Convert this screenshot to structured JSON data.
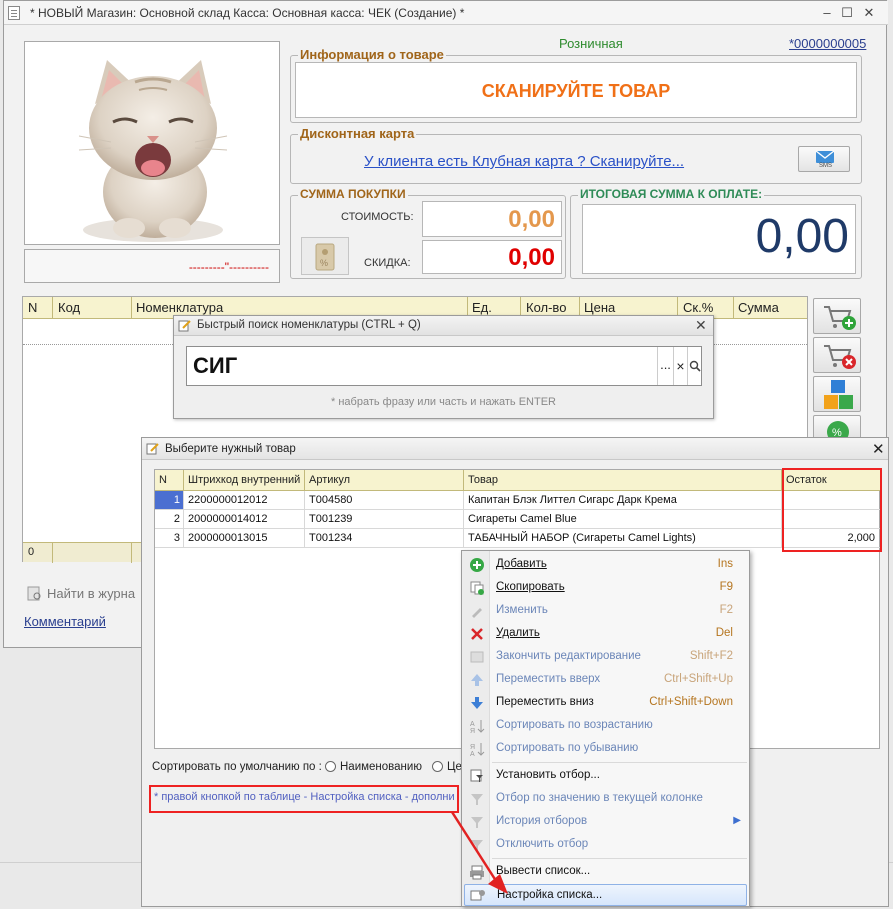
{
  "window": {
    "title": "* НОВЫЙ Магазин: Основной склад Касса: Основная касса: ЧЕК (Создание) *"
  },
  "header": {
    "price_type": "Розничная",
    "check_number": "*0000000005"
  },
  "photo": {
    "caption": "---------\"----------"
  },
  "product_info": {
    "title": "Информация о товаре",
    "scan_prompt": "СКАНИРУЙТЕ ТОВАР"
  },
  "discount_card": {
    "title": "Дисконтная карта",
    "link": "У клиента есть Клубная карта ? Сканируйте...",
    "sms_label": "SMS"
  },
  "purchase_sum": {
    "title": "СУММА ПОКУПКИ",
    "cost_label": "СТОИМОСТЬ:",
    "cost_value": "0,00",
    "discount_label": "СКИДКА:",
    "discount_value": "0,00"
  },
  "total": {
    "title": "ИТОГОВАЯ СУММА К ОПЛАТЕ:",
    "value": "0,00"
  },
  "grid": {
    "columns": [
      "N",
      "Код",
      "Номенклатура",
      "Ед.",
      "Кол-во",
      "Цена",
      "Ск.%",
      "Сумма"
    ],
    "footer_count": "0"
  },
  "bottom_links": {
    "find_in_journal": "Найти в журна",
    "comment": "Комментарий"
  },
  "quick_search": {
    "title": "Быстрый поиск номенклатуры (CTRL + Q)",
    "value": "СИГ",
    "ellipsis": "...",
    "clear": "×",
    "hint": "* набрать фразу или часть и нажать ENTER"
  },
  "select_dialog": {
    "title": "Выберите нужный товар",
    "columns": [
      "N",
      "Штрихкод внутренний",
      "Артикул",
      "Товар",
      "Остаток"
    ],
    "rows": [
      {
        "n": "1",
        "barcode": "2200000012012",
        "article": "Т004580",
        "name": "Капитан Блэк Литтел Сигарс Дарк Крема",
        "stock": ""
      },
      {
        "n": "2",
        "barcode": "2000000014012",
        "article": "Т001239",
        "name": "Сигареты Camel Blue",
        "stock": ""
      },
      {
        "n": "3",
        "barcode": "2000000013015",
        "article": "Т001234",
        "name": "ТАБАЧНЫЙ НАБОР (Сигареты Camel Lights)",
        "stock": "2,000"
      }
    ],
    "sort_label": "Сортировать по умолчанию по :",
    "sort_option_name": "Наименованию",
    "sort_option_other": "Цен",
    "footer_hint": "* правой кнопкой по таблице - Настройка списка - дополни"
  },
  "context_menu": {
    "items": [
      {
        "label": "Добавить",
        "shortcut": "Ins"
      },
      {
        "label": "Скопировать",
        "shortcut": "F9"
      },
      {
        "label": "Изменить",
        "shortcut": "F2"
      },
      {
        "label": "Удалить",
        "shortcut": "Del"
      },
      {
        "label": "Закончить редактирование",
        "shortcut": "Shift+F2"
      },
      {
        "label": "Переместить вверх",
        "shortcut": "Ctrl+Shift+Up"
      },
      {
        "label": "Переместить вниз",
        "shortcut": "Ctrl+Shift+Down"
      },
      {
        "label": "Сортировать по возрастанию",
        "shortcut": ""
      },
      {
        "label": "Сортировать по убыванию",
        "shortcut": ""
      },
      {
        "label": "Установить отбор...",
        "shortcut": ""
      },
      {
        "label": "Отбор по значению в текущей колонке",
        "shortcut": ""
      },
      {
        "label": "История отборов",
        "shortcut": ""
      },
      {
        "label": "Отключить отбор",
        "shortcut": ""
      },
      {
        "label": "Вывести список...",
        "shortcut": ""
      },
      {
        "label": "Настройка списка...",
        "shortcut": ""
      }
    ]
  },
  "colors": {
    "accent_orange": "#f07017",
    "group_title": "#a0651a",
    "total_blue": "#1f3a68",
    "discount_red": "#e00000",
    "link_blue": "#2a51c7",
    "highlight_red": "#e22222"
  }
}
